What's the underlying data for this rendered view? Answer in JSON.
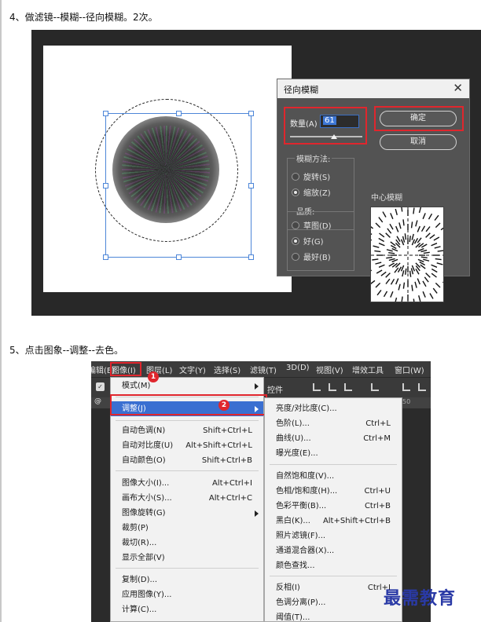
{
  "step4": {
    "text": "4、做滤镜--模糊--径向模糊。2次。"
  },
  "dialog": {
    "title": "径向模糊",
    "amount_label": "数量(A)",
    "amount_value": "61",
    "amount_fraction": 0.61,
    "ok": "确定",
    "cancel": "取消",
    "method_title": "模糊方法:",
    "method_options": [
      {
        "label": "旋转(S)",
        "selected": false
      },
      {
        "label": "缩放(Z)",
        "selected": true
      }
    ],
    "quality_title": "品质:",
    "quality_options": [
      {
        "label": "草图(D)",
        "selected": false
      },
      {
        "label": "好(G)",
        "selected": true
      },
      {
        "label": "最好(B)",
        "selected": false
      }
    ],
    "center_label": "中心模糊"
  },
  "step5": {
    "text": "5、点击图象--调整--去色。"
  },
  "menubar": [
    "编辑(E)",
    "图像(I)",
    "图层(L)",
    "文字(Y)",
    "选择(S)",
    "滤镜(T)",
    "3D(D)",
    "视图(V)",
    "增效工具",
    "窗口(W)"
  ],
  "toolbar_text": "控件",
  "tab_text": "@",
  "ruler_text": "50",
  "image_menu": {
    "items": [
      {
        "label": "模式(M)",
        "shortcut": "",
        "submenu": true
      },
      {
        "label": "调整(J)",
        "shortcut": "",
        "submenu": true,
        "highlighted": true
      },
      {
        "label": "自动色调(N)",
        "shortcut": "Shift+Ctrl+L"
      },
      {
        "label": "自动对比度(U)",
        "shortcut": "Alt+Shift+Ctrl+L"
      },
      {
        "label": "自动颜色(O)",
        "shortcut": "Shift+Ctrl+B"
      },
      {
        "label": "图像大小(I)...",
        "shortcut": "Alt+Ctrl+I"
      },
      {
        "label": "画布大小(S)...",
        "shortcut": "Alt+Ctrl+C"
      },
      {
        "label": "图像旋转(G)",
        "shortcut": "",
        "submenu": true
      },
      {
        "label": "裁剪(P)",
        "shortcut": ""
      },
      {
        "label": "裁切(R)...",
        "shortcut": ""
      },
      {
        "label": "显示全部(V)",
        "shortcut": ""
      },
      {
        "label": "复制(D)...",
        "shortcut": ""
      },
      {
        "label": "应用图像(Y)...",
        "shortcut": ""
      },
      {
        "label": "计算(C)...",
        "shortcut": ""
      }
    ]
  },
  "adjust_menu": {
    "items": [
      {
        "label": "亮度/对比度(C)...",
        "shortcut": ""
      },
      {
        "label": "色阶(L)...",
        "shortcut": "Ctrl+L"
      },
      {
        "label": "曲线(U)...",
        "shortcut": "Ctrl+M"
      },
      {
        "label": "曝光度(E)...",
        "shortcut": ""
      },
      {
        "label": "自然饱和度(V)...",
        "shortcut": ""
      },
      {
        "label": "色相/饱和度(H)...",
        "shortcut": "Ctrl+U"
      },
      {
        "label": "色彩平衡(B)...",
        "shortcut": "Ctrl+B"
      },
      {
        "label": "黑白(K)...",
        "shortcut": "Alt+Shift+Ctrl+B"
      },
      {
        "label": "照片滤镜(F)...",
        "shortcut": ""
      },
      {
        "label": "通道混合器(X)...",
        "shortcut": ""
      },
      {
        "label": "颜色查找...",
        "shortcut": ""
      },
      {
        "label": "反相(I)",
        "shortcut": "Ctrl+I"
      },
      {
        "label": "色调分离(P)...",
        "shortcut": ""
      },
      {
        "label": "阈值(T)...",
        "shortcut": ""
      }
    ]
  },
  "badges": [
    "1",
    "2"
  ],
  "watermark": "最需教育",
  "colors": {
    "highlight": "#3a6fd1",
    "annotation_red": "#e0262d",
    "watermark": "#2a3aa6"
  }
}
